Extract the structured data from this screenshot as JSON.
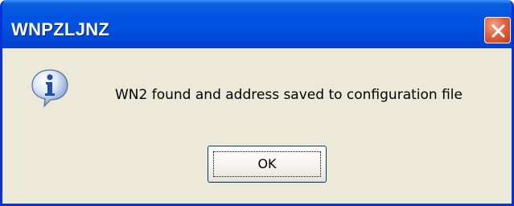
{
  "dialog": {
    "title": "WNPZLJNZ",
    "message": "WN2 found and address saved to configuration file",
    "icon": "info-icon",
    "ok_label": "OK",
    "close_icon": "close-icon"
  },
  "colors": {
    "titlebar": "#0054e3",
    "frame": "#0831d9",
    "body": "#ece9d8",
    "close_button": "#e3643f"
  }
}
